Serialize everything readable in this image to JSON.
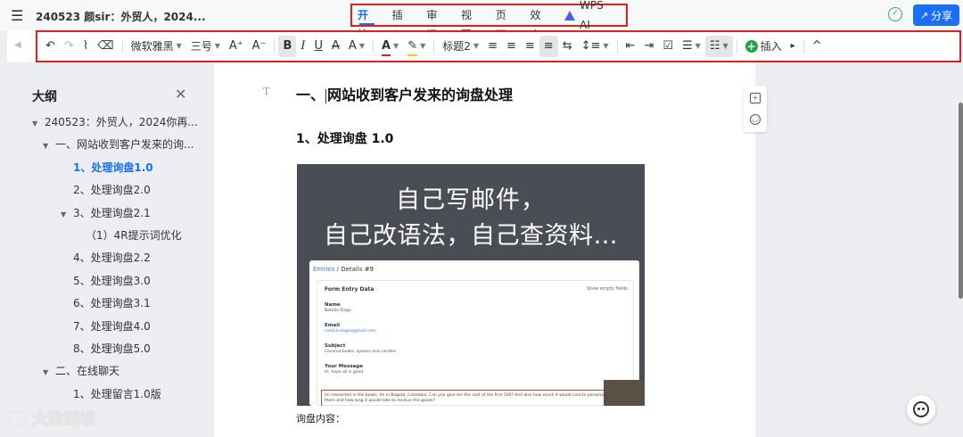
{
  "app": {
    "doc_title": "240523 颜sir：外贸人，2024...",
    "share_label": "分享"
  },
  "main_tabs": [
    {
      "label": "开始",
      "active": true
    },
    {
      "label": "插入",
      "active": false
    },
    {
      "label": "审阅",
      "active": false
    },
    {
      "label": "视图",
      "active": false
    },
    {
      "label": "页面",
      "active": false
    },
    {
      "label": "效率",
      "active": false
    },
    {
      "label": "WPS AI",
      "active": false
    }
  ],
  "toolbar": {
    "undo_icon": "↶",
    "redo_icon": "↷",
    "format_painter_icon": "⌇",
    "eraser_icon": "⌫",
    "font_family": "微软雅黑",
    "font_size": "三号",
    "grow_font": "A⁺",
    "shrink_font": "A⁻",
    "bold": "B",
    "italic": "I",
    "underline": "U",
    "strike": "A",
    "superscript": "A",
    "font_color": "A",
    "highlight": "✎",
    "style": "标题2",
    "align_left": "≡",
    "align_center": "≡",
    "align_right": "≡",
    "justify": "≡",
    "distribute": "⇆",
    "line_spacing": "↕≡",
    "outdent": "⇤",
    "indent": "⇥",
    "checkbox": "☑",
    "bullets": "☰",
    "numbering": "☷",
    "insert_label": "插入",
    "more": "▸",
    "collapse": "^"
  },
  "sidebar": {
    "title": "大纲",
    "items": [
      {
        "label": "240523：外贸人，2024你再...",
        "level": 0,
        "expanded": true,
        "active": false
      },
      {
        "label": "一、网站收到客户发来的询...",
        "level": 1,
        "expanded": true,
        "active": false
      },
      {
        "label": "1、处理询盘1.0",
        "level": 2,
        "expanded": false,
        "active": true
      },
      {
        "label": "2、处理询盘2.0",
        "level": 2,
        "expanded": false,
        "active": false
      },
      {
        "label": "3、处理询盘2.1",
        "level": 2,
        "expanded": true,
        "active": false
      },
      {
        "label": "（1）4R提示词优化",
        "level": 3,
        "expanded": false,
        "active": false
      },
      {
        "label": "4、处理询盘2.2",
        "level": 2,
        "expanded": false,
        "active": false
      },
      {
        "label": "5、处理询盘3.0",
        "level": 2,
        "expanded": false,
        "active": false
      },
      {
        "label": "6、处理询盘3.1",
        "level": 2,
        "expanded": false,
        "active": false
      },
      {
        "label": "7、处理询盘4.0",
        "level": 2,
        "expanded": false,
        "active": false
      },
      {
        "label": "8、处理询盘5.0",
        "level": 2,
        "expanded": false,
        "active": false
      },
      {
        "label": "二、在线聊天",
        "level": 1,
        "expanded": true,
        "active": false
      },
      {
        "label": "1、处理留言1.0版",
        "level": 2,
        "expanded": false,
        "active": false
      }
    ]
  },
  "watermark": "大数跨境",
  "document": {
    "h1_before_caret": "一、",
    "h1_after_caret": "网站收到客户发来的询盘处理",
    "h2": "1、处理询盘 1.0",
    "image": {
      "line1": "自己写邮件，",
      "line2": "自己改语法，自己查资料…",
      "crumb_link": "Entries",
      "crumb_sep": " / ",
      "crumb_current": "Details #9",
      "card_title": "Form Entry Data",
      "toggle_label": "Show empty fields",
      "fields": [
        {
          "label": "Name",
          "value": "Natalia Elago"
        },
        {
          "label": "Email",
          "value": "natalia.elago@gmail.com"
        },
        {
          "label": "Subject",
          "value": "Coconut bowls, spoons and candles"
        },
        {
          "label": "Your Message",
          "value": "Hi, hope all is good"
        }
      ],
      "message_text": "Im interested in the bowls. Im in Bogotá, Colombia. Can you give me the cost of the first 100? And also how much it would cost to personalize them and how long it would take to receive the goods?"
    },
    "body_text": "询盘内容："
  }
}
